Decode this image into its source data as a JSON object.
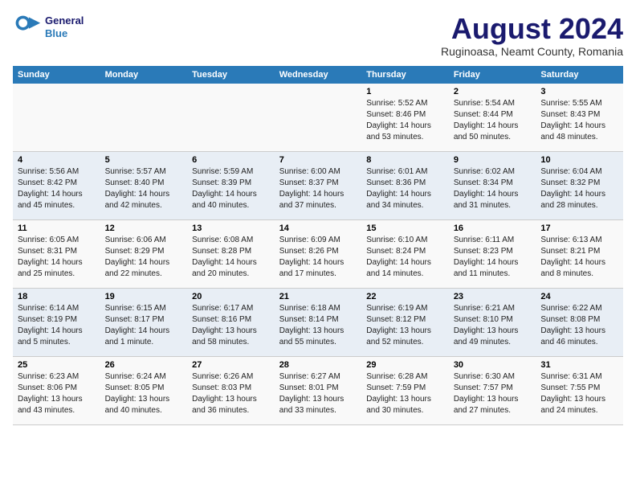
{
  "header": {
    "logo_line1": "General",
    "logo_line2": "Blue",
    "month_year": "August 2024",
    "location": "Ruginoasa, Neamt County, Romania"
  },
  "columns": [
    "Sunday",
    "Monday",
    "Tuesday",
    "Wednesday",
    "Thursday",
    "Friday",
    "Saturday"
  ],
  "weeks": [
    [
      {
        "day": "",
        "info": ""
      },
      {
        "day": "",
        "info": ""
      },
      {
        "day": "",
        "info": ""
      },
      {
        "day": "",
        "info": ""
      },
      {
        "day": "1",
        "info": "Sunrise: 5:52 AM\nSunset: 8:46 PM\nDaylight: 14 hours\nand 53 minutes."
      },
      {
        "day": "2",
        "info": "Sunrise: 5:54 AM\nSunset: 8:44 PM\nDaylight: 14 hours\nand 50 minutes."
      },
      {
        "day": "3",
        "info": "Sunrise: 5:55 AM\nSunset: 8:43 PM\nDaylight: 14 hours\nand 48 minutes."
      }
    ],
    [
      {
        "day": "4",
        "info": "Sunrise: 5:56 AM\nSunset: 8:42 PM\nDaylight: 14 hours\nand 45 minutes."
      },
      {
        "day": "5",
        "info": "Sunrise: 5:57 AM\nSunset: 8:40 PM\nDaylight: 14 hours\nand 42 minutes."
      },
      {
        "day": "6",
        "info": "Sunrise: 5:59 AM\nSunset: 8:39 PM\nDaylight: 14 hours\nand 40 minutes."
      },
      {
        "day": "7",
        "info": "Sunrise: 6:00 AM\nSunset: 8:37 PM\nDaylight: 14 hours\nand 37 minutes."
      },
      {
        "day": "8",
        "info": "Sunrise: 6:01 AM\nSunset: 8:36 PM\nDaylight: 14 hours\nand 34 minutes."
      },
      {
        "day": "9",
        "info": "Sunrise: 6:02 AM\nSunset: 8:34 PM\nDaylight: 14 hours\nand 31 minutes."
      },
      {
        "day": "10",
        "info": "Sunrise: 6:04 AM\nSunset: 8:32 PM\nDaylight: 14 hours\nand 28 minutes."
      }
    ],
    [
      {
        "day": "11",
        "info": "Sunrise: 6:05 AM\nSunset: 8:31 PM\nDaylight: 14 hours\nand 25 minutes."
      },
      {
        "day": "12",
        "info": "Sunrise: 6:06 AM\nSunset: 8:29 PM\nDaylight: 14 hours\nand 22 minutes."
      },
      {
        "day": "13",
        "info": "Sunrise: 6:08 AM\nSunset: 8:28 PM\nDaylight: 14 hours\nand 20 minutes."
      },
      {
        "day": "14",
        "info": "Sunrise: 6:09 AM\nSunset: 8:26 PM\nDaylight: 14 hours\nand 17 minutes."
      },
      {
        "day": "15",
        "info": "Sunrise: 6:10 AM\nSunset: 8:24 PM\nDaylight: 14 hours\nand 14 minutes."
      },
      {
        "day": "16",
        "info": "Sunrise: 6:11 AM\nSunset: 8:23 PM\nDaylight: 14 hours\nand 11 minutes."
      },
      {
        "day": "17",
        "info": "Sunrise: 6:13 AM\nSunset: 8:21 PM\nDaylight: 14 hours\nand 8 minutes."
      }
    ],
    [
      {
        "day": "18",
        "info": "Sunrise: 6:14 AM\nSunset: 8:19 PM\nDaylight: 14 hours\nand 5 minutes."
      },
      {
        "day": "19",
        "info": "Sunrise: 6:15 AM\nSunset: 8:17 PM\nDaylight: 14 hours\nand 1 minute."
      },
      {
        "day": "20",
        "info": "Sunrise: 6:17 AM\nSunset: 8:16 PM\nDaylight: 13 hours\nand 58 minutes."
      },
      {
        "day": "21",
        "info": "Sunrise: 6:18 AM\nSunset: 8:14 PM\nDaylight: 13 hours\nand 55 minutes."
      },
      {
        "day": "22",
        "info": "Sunrise: 6:19 AM\nSunset: 8:12 PM\nDaylight: 13 hours\nand 52 minutes."
      },
      {
        "day": "23",
        "info": "Sunrise: 6:21 AM\nSunset: 8:10 PM\nDaylight: 13 hours\nand 49 minutes."
      },
      {
        "day": "24",
        "info": "Sunrise: 6:22 AM\nSunset: 8:08 PM\nDaylight: 13 hours\nand 46 minutes."
      }
    ],
    [
      {
        "day": "25",
        "info": "Sunrise: 6:23 AM\nSunset: 8:06 PM\nDaylight: 13 hours\nand 43 minutes."
      },
      {
        "day": "26",
        "info": "Sunrise: 6:24 AM\nSunset: 8:05 PM\nDaylight: 13 hours\nand 40 minutes."
      },
      {
        "day": "27",
        "info": "Sunrise: 6:26 AM\nSunset: 8:03 PM\nDaylight: 13 hours\nand 36 minutes."
      },
      {
        "day": "28",
        "info": "Sunrise: 6:27 AM\nSunset: 8:01 PM\nDaylight: 13 hours\nand 33 minutes."
      },
      {
        "day": "29",
        "info": "Sunrise: 6:28 AM\nSunset: 7:59 PM\nDaylight: 13 hours\nand 30 minutes."
      },
      {
        "day": "30",
        "info": "Sunrise: 6:30 AM\nSunset: 7:57 PM\nDaylight: 13 hours\nand 27 minutes."
      },
      {
        "day": "31",
        "info": "Sunrise: 6:31 AM\nSunset: 7:55 PM\nDaylight: 13 hours\nand 24 minutes."
      }
    ]
  ]
}
